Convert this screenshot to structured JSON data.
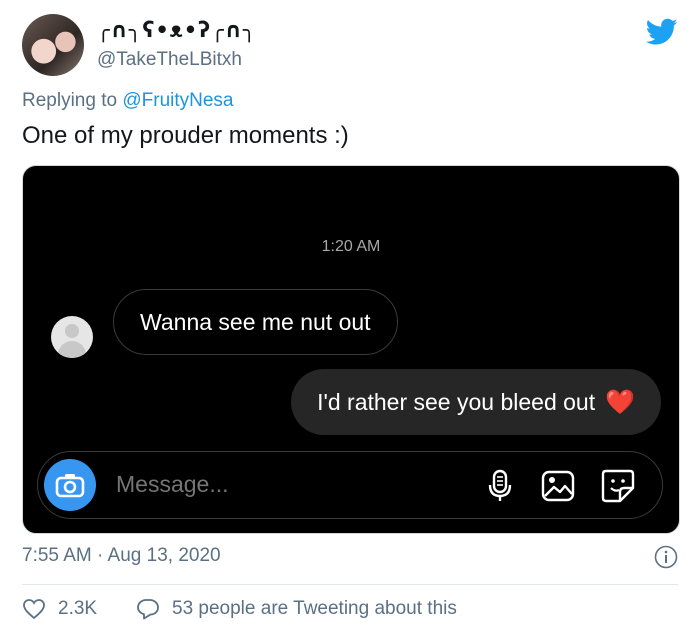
{
  "author": {
    "display_name": "╭∩╮ʕ•ᴥ•ʔ╭∩╮",
    "handle": "@TakeTheLBitxh"
  },
  "reply": {
    "prefix": "Replying to ",
    "mention": "@FruityNesa"
  },
  "tweet": {
    "text": "One of my prouder moments :)"
  },
  "dm": {
    "time": "1:20 AM",
    "received_message": "Wanna see me nut out",
    "sent_message": "I'd rather see you bleed out",
    "sent_emoji": "❤️",
    "composer_placeholder": "Message..."
  },
  "meta": {
    "timestamp": "7:55 AM · Aug 13, 2020"
  },
  "actions": {
    "likes": "2.3K",
    "discussion": "53 people are Tweeting about this"
  },
  "colors": {
    "twitter_blue": "#1da1f2",
    "link_blue": "#1b95e0",
    "camera_blue": "#3797f0",
    "heart_red": "#e8283a"
  }
}
